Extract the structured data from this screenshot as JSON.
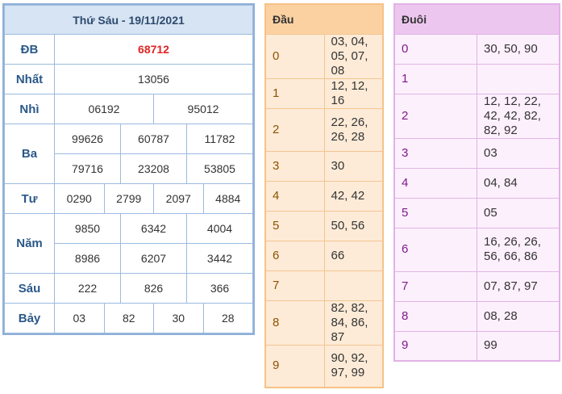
{
  "results": {
    "title": "Thứ Sáu - 19/11/2021",
    "db": {
      "label": "ĐB",
      "values": [
        "68712"
      ]
    },
    "nhat": {
      "label": "Nhất",
      "values": [
        "13056"
      ]
    },
    "nhi": {
      "label": "Nhì",
      "values": [
        "06192",
        "95012"
      ]
    },
    "ba": {
      "label": "Ba",
      "values": [
        "99626",
        "60787",
        "11782",
        "79716",
        "23208",
        "53805"
      ]
    },
    "tu": {
      "label": "Tư",
      "values": [
        "0290",
        "2799",
        "2097",
        "4884"
      ]
    },
    "nam": {
      "label": "Năm",
      "values": [
        "9850",
        "6342",
        "4004",
        "8986",
        "6207",
        "3442"
      ]
    },
    "sau": {
      "label": "Sáu",
      "values": [
        "222",
        "826",
        "366"
      ]
    },
    "bay": {
      "label": "Bảy",
      "values": [
        "03",
        "82",
        "30",
        "28"
      ]
    }
  },
  "dau": {
    "header": "Đầu",
    "rows": [
      {
        "k": "0",
        "v": "03, 04, 05, 07, 08"
      },
      {
        "k": "1",
        "v": "12, 12, 16"
      },
      {
        "k": "2",
        "v": "22, 26, 26, 28"
      },
      {
        "k": "3",
        "v": "30"
      },
      {
        "k": "4",
        "v": "42, 42"
      },
      {
        "k": "5",
        "v": "50, 56"
      },
      {
        "k": "6",
        "v": "66"
      },
      {
        "k": "7",
        "v": ""
      },
      {
        "k": "8",
        "v": "82, 82, 84, 86, 87"
      },
      {
        "k": "9",
        "v": "90, 92, 97, 99"
      }
    ]
  },
  "duoi": {
    "header": "Đuôi",
    "rows": [
      {
        "k": "0",
        "v": "30, 50, 90"
      },
      {
        "k": "1",
        "v": ""
      },
      {
        "k": "2",
        "v": "12, 12, 22, 42, 42, 82, 82, 92"
      },
      {
        "k": "3",
        "v": "03"
      },
      {
        "k": "4",
        "v": "04, 84"
      },
      {
        "k": "5",
        "v": "05"
      },
      {
        "k": "6",
        "v": "16, 26, 26, 56, 66, 86"
      },
      {
        "k": "7",
        "v": "07, 87, 97"
      },
      {
        "k": "8",
        "v": "08, 28"
      },
      {
        "k": "9",
        "v": "99"
      }
    ]
  }
}
